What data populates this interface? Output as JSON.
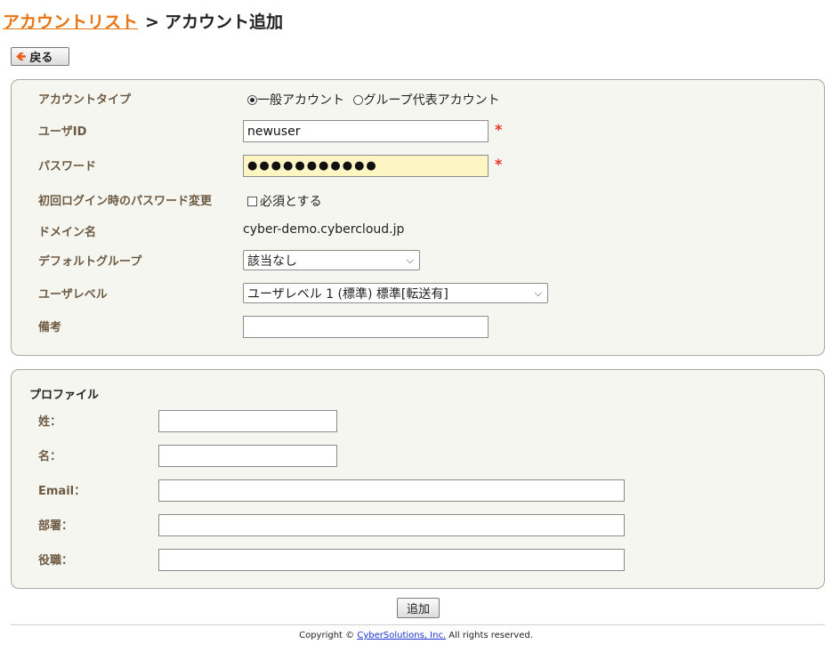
{
  "breadcrumb": {
    "parent": "アカウントリスト",
    "separator": ">",
    "current": "アカウント追加"
  },
  "back_button": {
    "icon": "arrow-left-icon",
    "label": "戻る"
  },
  "account": {
    "type": {
      "label": "アカウントタイプ",
      "options": [
        "一般アカウント",
        "グループ代表アカウント"
      ],
      "selected": "一般アカウント"
    },
    "user_id": {
      "label": "ユーザID",
      "value": "newuser",
      "required_mark": "*"
    },
    "password": {
      "label": "パスワード",
      "masked_value": "●●●●●●●●●●●",
      "required_mark": "*"
    },
    "pw_change": {
      "label": "初回ログイン時のパスワード変更",
      "checkbox_label": "必須とする",
      "checked": false
    },
    "domain": {
      "label": "ドメイン名",
      "value": "cyber-demo.cybercloud.jp"
    },
    "default_group": {
      "label": "デフォルトグループ",
      "value": "該当なし"
    },
    "user_level": {
      "label": "ユーザレベル",
      "value": "ユーザレベル 1 (標準) 標準[転送有]"
    },
    "note": {
      "label": "備考",
      "value": ""
    }
  },
  "profile": {
    "title": "プロファイル",
    "last_name": {
      "label": "姓：",
      "value": ""
    },
    "first_name": {
      "label": "名：",
      "value": ""
    },
    "email": {
      "label": "Email：",
      "value": ""
    },
    "department": {
      "label": "部署：",
      "value": ""
    },
    "position": {
      "label": "役職：",
      "value": ""
    }
  },
  "submit_label": "追加",
  "footer": {
    "prefix": "Copyright © ",
    "link": "CyberSolutions, Inc.",
    "suffix": " All rights reserved."
  },
  "colors": {
    "link": "#e87511",
    "panel_bg": "#f6f6f1",
    "label": "#6d5a42",
    "required": "#e8352a",
    "password_bg": "#fdf5c4"
  }
}
